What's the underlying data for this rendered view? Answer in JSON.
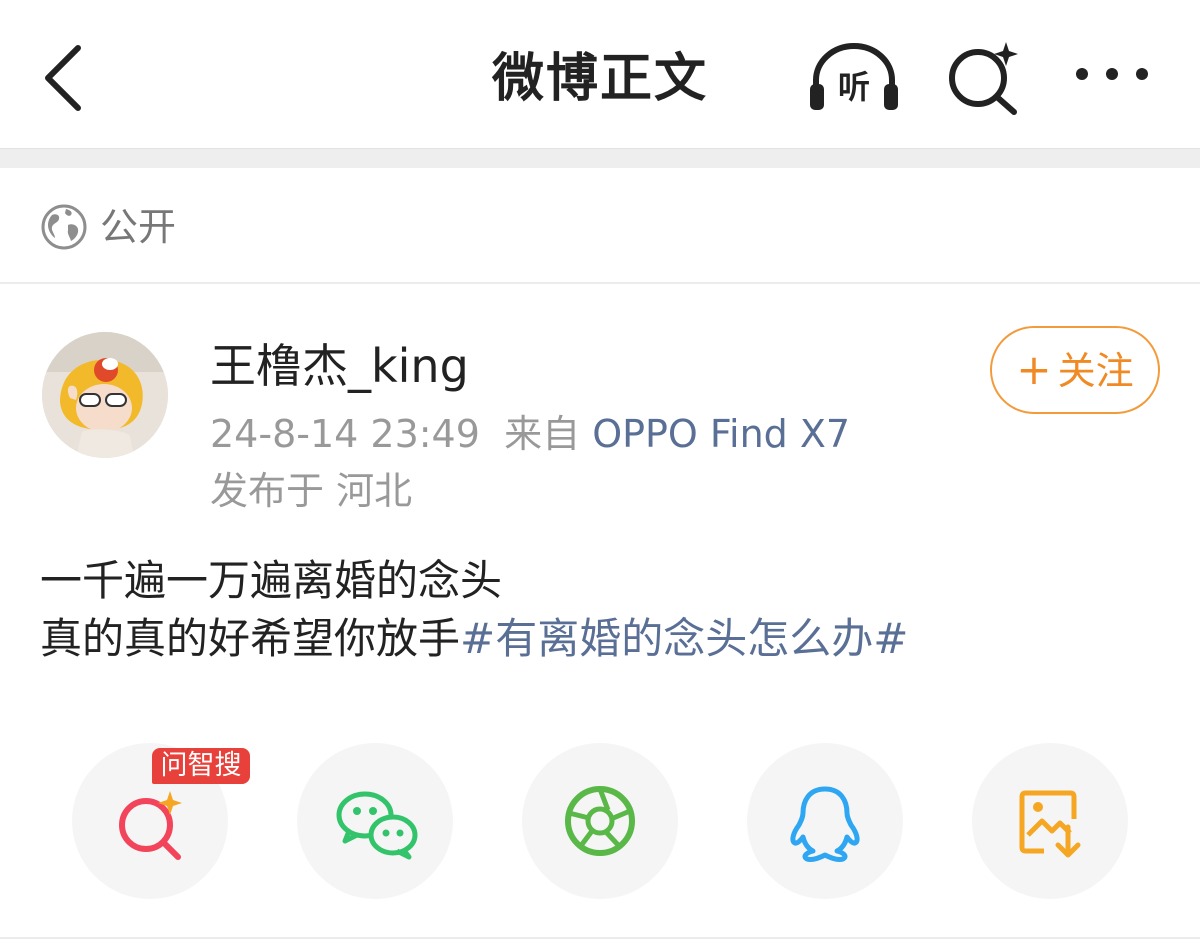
{
  "header": {
    "title": "微博正文",
    "back_icon": "chevron-left-icon",
    "listen_label": "听",
    "listen_icon": "headphones-icon",
    "search_icon": "ai-search-icon",
    "more_icon": "more-dots-icon"
  },
  "visibility": {
    "icon": "globe-icon",
    "label": "公开"
  },
  "post": {
    "author": "王橹杰_king",
    "timestamp": "24-8-14 23:49",
    "source_prefix": "来自",
    "device": "OPPO Find X7",
    "location": "发布于 河北",
    "follow_plus": "+",
    "follow_label": "关注",
    "text_line1": "一千遍一万遍离婚的念头",
    "text_line2_plain": "真的真的好希望你放手",
    "hashtag": "#有离婚的念头怎么办#"
  },
  "share": {
    "badge": "问智搜",
    "items": [
      {
        "icon": "ai-search-icon",
        "color": "#f2445a"
      },
      {
        "icon": "wechat-icon",
        "color": "#33c46b"
      },
      {
        "icon": "moments-icon",
        "color": "#59b847"
      },
      {
        "icon": "qq-icon",
        "color": "#2ea6f2"
      },
      {
        "icon": "save-image-icon",
        "color": "#f5a623"
      }
    ]
  }
}
